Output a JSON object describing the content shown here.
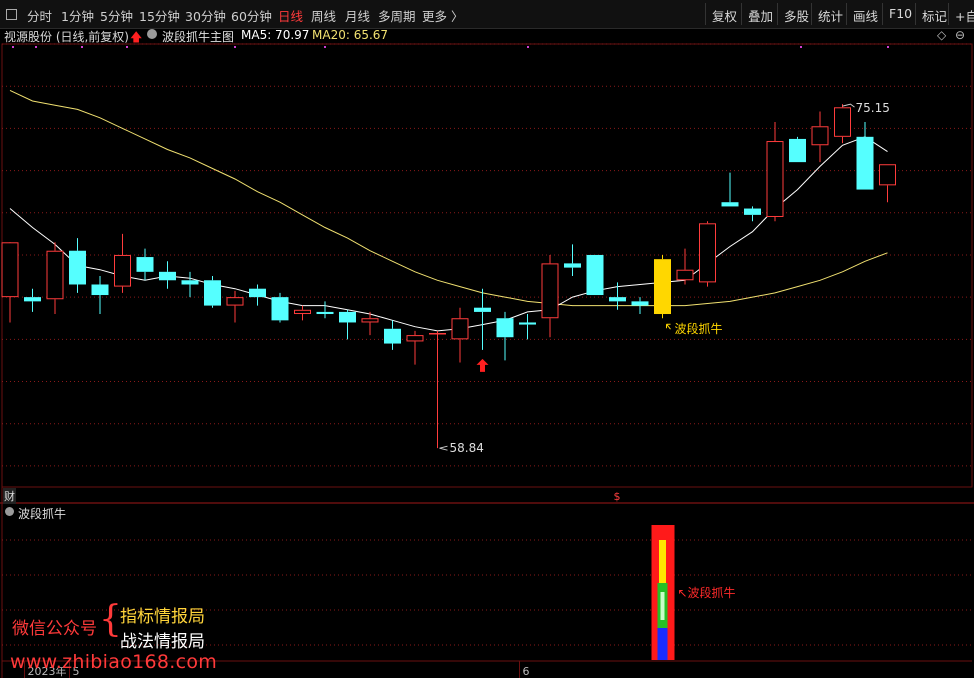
{
  "toolbar": {
    "periods": [
      "分时",
      "1分钟",
      "5分钟",
      "15分钟",
      "30分钟",
      "60分钟",
      "日线",
      "周线",
      "月线",
      "多周期",
      "更多 〉"
    ],
    "active_period": "日线",
    "right_buttons": [
      "复权",
      "叠加",
      "多股",
      "统计",
      "画线",
      "F10",
      "标记",
      "+自"
    ]
  },
  "info": {
    "stock_name": "视源股份 (日线,前复权)",
    "indicator_name": "波段抓牛主图",
    "ma5_label": "MA5: 70.97",
    "ma20_label": "MA20: 65.67"
  },
  "indicator_panel": {
    "title": "波段抓牛",
    "signal_label": "波段抓牛"
  },
  "watermark": {
    "wechat": "微信公众号",
    "brace": "{",
    "line1": "指标情报局",
    "line2": "战法情报局",
    "url": "www.zhibiao168.com"
  },
  "colors": {
    "up": "#ff3c3c",
    "down": "#55ffff",
    "ma5": "#ffffff",
    "ma20": "#f0e070",
    "signal": "#ffd700",
    "grid": "#8a1a1a"
  },
  "chart_data": {
    "type": "candlestick",
    "title": "视源股份 (日线,前复权)",
    "y_range": [
      57,
      78
    ],
    "max_label": "75.15",
    "min_label": "58.84",
    "signal_text": "波段抓牛",
    "axis_labels": [
      {
        "text": "2023年",
        "index": 1
      },
      {
        "text": "5",
        "index": 3
      },
      {
        "text": "6",
        "index": 23
      }
    ],
    "misc_markers": {
      "cai": "财",
      "dollar": "$"
    },
    "candles": [
      {
        "o": 66.0,
        "h": 67.8,
        "l": 64.8,
        "c": 68.6
      },
      {
        "o": 66.0,
        "h": 66.4,
        "l": 65.3,
        "c": 65.8
      },
      {
        "o": 65.9,
        "h": 68.6,
        "l": 65.2,
        "c": 68.2
      },
      {
        "o": 68.2,
        "h": 68.8,
        "l": 66.2,
        "c": 66.6
      },
      {
        "o": 66.6,
        "h": 67.0,
        "l": 65.2,
        "c": 66.1
      },
      {
        "o": 66.5,
        "h": 69.0,
        "l": 66.2,
        "c": 68.0
      },
      {
        "o": 67.9,
        "h": 68.3,
        "l": 66.8,
        "c": 67.2
      },
      {
        "o": 67.2,
        "h": 67.7,
        "l": 66.4,
        "c": 66.8
      },
      {
        "o": 66.8,
        "h": 67.2,
        "l": 66.0,
        "c": 66.6
      },
      {
        "o": 66.8,
        "h": 67.0,
        "l": 65.5,
        "c": 65.6
      },
      {
        "o": 65.6,
        "h": 66.3,
        "l": 64.8,
        "c": 66.0
      },
      {
        "o": 66.4,
        "h": 66.6,
        "l": 65.6,
        "c": 66.0
      },
      {
        "o": 66.0,
        "h": 66.2,
        "l": 64.8,
        "c": 64.9
      },
      {
        "o": 65.2,
        "h": 65.6,
        "l": 64.9,
        "c": 65.4
      },
      {
        "o": 65.3,
        "h": 65.8,
        "l": 65.0,
        "c": 65.2
      },
      {
        "o": 65.3,
        "h": 65.4,
        "l": 64.0,
        "c": 64.8
      },
      {
        "o": 64.8,
        "h": 65.3,
        "l": 64.2,
        "c": 65.0
      },
      {
        "o": 64.5,
        "h": 64.9,
        "l": 63.5,
        "c": 63.8
      },
      {
        "o": 63.9,
        "h": 64.4,
        "l": 62.8,
        "c": 64.2
      },
      {
        "o": 64.3,
        "h": 64.4,
        "l": 58.84,
        "c": 64.3
      },
      {
        "o": 64.0,
        "h": 65.5,
        "l": 62.9,
        "c": 65.0
      },
      {
        "o": 65.5,
        "h": 66.4,
        "l": 63.5,
        "c": 65.3
      },
      {
        "o": 65.0,
        "h": 65.3,
        "l": 63.0,
        "c": 64.1
      },
      {
        "o": 64.8,
        "h": 65.2,
        "l": 64.0,
        "c": 64.7
      },
      {
        "o": 65.0,
        "h": 68.0,
        "l": 64.1,
        "c": 67.6
      },
      {
        "o": 67.6,
        "h": 68.5,
        "l": 67.0,
        "c": 67.4
      },
      {
        "o": 68.0,
        "h": 68.0,
        "l": 66.1,
        "c": 66.1
      },
      {
        "o": 66.0,
        "h": 66.7,
        "l": 65.4,
        "c": 65.8
      },
      {
        "o": 65.8,
        "h": 66.0,
        "l": 65.2,
        "c": 65.6
      },
      {
        "o": 65.2,
        "h": 68.0,
        "l": 65.0,
        "c": 67.8
      },
      {
        "o": 66.8,
        "h": 68.3,
        "l": 66.6,
        "c": 67.3
      },
      {
        "o": 66.7,
        "h": 69.6,
        "l": 66.5,
        "c": 69.5
      },
      {
        "o": 70.5,
        "h": 71.9,
        "l": 70.3,
        "c": 70.3
      },
      {
        "o": 70.2,
        "h": 70.3,
        "l": 69.6,
        "c": 69.9
      },
      {
        "o": 69.8,
        "h": 74.3,
        "l": 69.6,
        "c": 73.4
      },
      {
        "o": 73.5,
        "h": 73.6,
        "l": 72.4,
        "c": 72.4
      },
      {
        "o": 73.2,
        "h": 74.8,
        "l": 72.4,
        "c": 74.1
      },
      {
        "o": 73.6,
        "h": 75.15,
        "l": 73.3,
        "c": 75.0
      },
      {
        "o": 73.6,
        "h": 74.3,
        "l": 71.1,
        "c": 71.1
      },
      {
        "o": 71.3,
        "h": 72.3,
        "l": 70.5,
        "c": 72.3
      }
    ],
    "ma5": [
      70.2,
      69.3,
      68.5,
      67.5,
      67.3,
      67.0,
      66.8,
      67.0,
      66.9,
      66.6,
      66.4,
      66.1,
      65.8,
      65.6,
      65.6,
      65.4,
      65.2,
      64.9,
      64.6,
      64.4,
      64.5,
      64.7,
      64.9,
      65.3,
      65.4,
      66.0,
      66.3,
      66.5,
      66.6,
      66.7,
      66.8,
      67.6,
      68.4,
      69.1,
      70.2,
      71.1,
      72.2,
      73.2,
      73.6,
      72.9
    ],
    "ma20": [
      75.8,
      75.3,
      75.1,
      74.9,
      74.5,
      74.0,
      73.5,
      73.0,
      72.6,
      72.1,
      71.6,
      71.0,
      70.5,
      69.9,
      69.3,
      68.8,
      68.2,
      67.7,
      67.2,
      66.8,
      66.5,
      66.2,
      66.0,
      65.8,
      65.7,
      65.6,
      65.6,
      65.6,
      65.6,
      65.6,
      65.6,
      65.7,
      65.8,
      66.0,
      66.2,
      66.5,
      66.8,
      67.2,
      67.7,
      68.1
    ],
    "signal_index": 29,
    "buy_arrow_index": 21
  }
}
